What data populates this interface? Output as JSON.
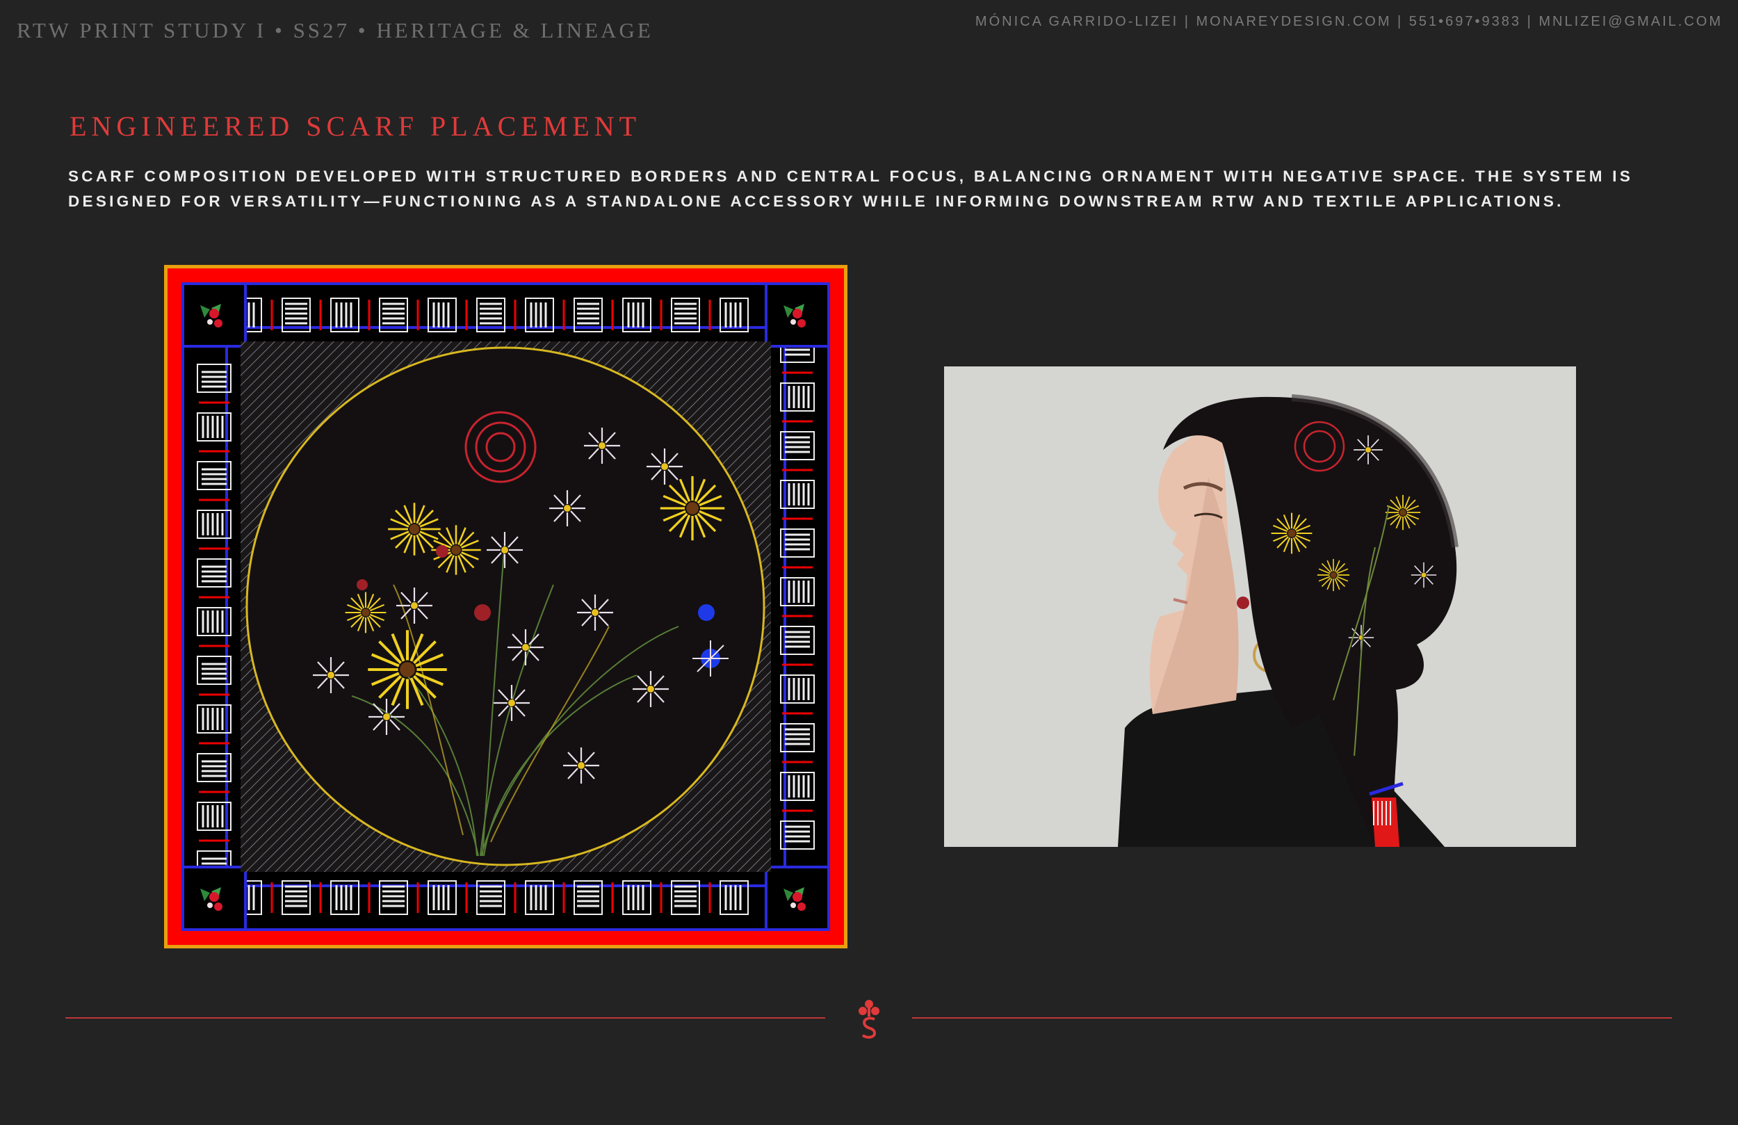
{
  "header": {
    "project_title": "RTW PRINT STUDY I • SS27 • HERITAGE & LINEAGE",
    "contact": "MÓNICA GARRIDO-LIZEI | MONAREYDESIGN.COM | 551•697•9383 | MNLIZEI@GMAIL.COM"
  },
  "section": {
    "title": "ENGINEERED SCARF PLACEMENT",
    "description": "SCARF COMPOSITION DEVELOPED WITH STRUCTURED BORDERS AND CENTRAL FOCUS, BALANCING ORNAMENT WITH NEGATIVE SPACE. THE SYSTEM IS DESIGNED FOR VERSATILITY—FUNCTIONING AS A STANDALONE ACCESSORY WHILE INFORMING DOWNSTREAM RTW AND TEXTILE APPLICATIONS."
  },
  "colors": {
    "background": "#232323",
    "accent_red": "#e03a3a",
    "scarf_frame_gold": "#e8a010",
    "scarf_border_red": "#ff0000",
    "scarf_band_blue": "#2a2ae0",
    "scarf_ground": "#141012",
    "medallion_gold": "#d8b820"
  },
  "images": {
    "scarf_artwork": "engineered-scarf-print",
    "model_photo": "model-wearing-headscarf-profile"
  },
  "footer": {
    "ornament_icon": "monogram-ornament-icon"
  }
}
